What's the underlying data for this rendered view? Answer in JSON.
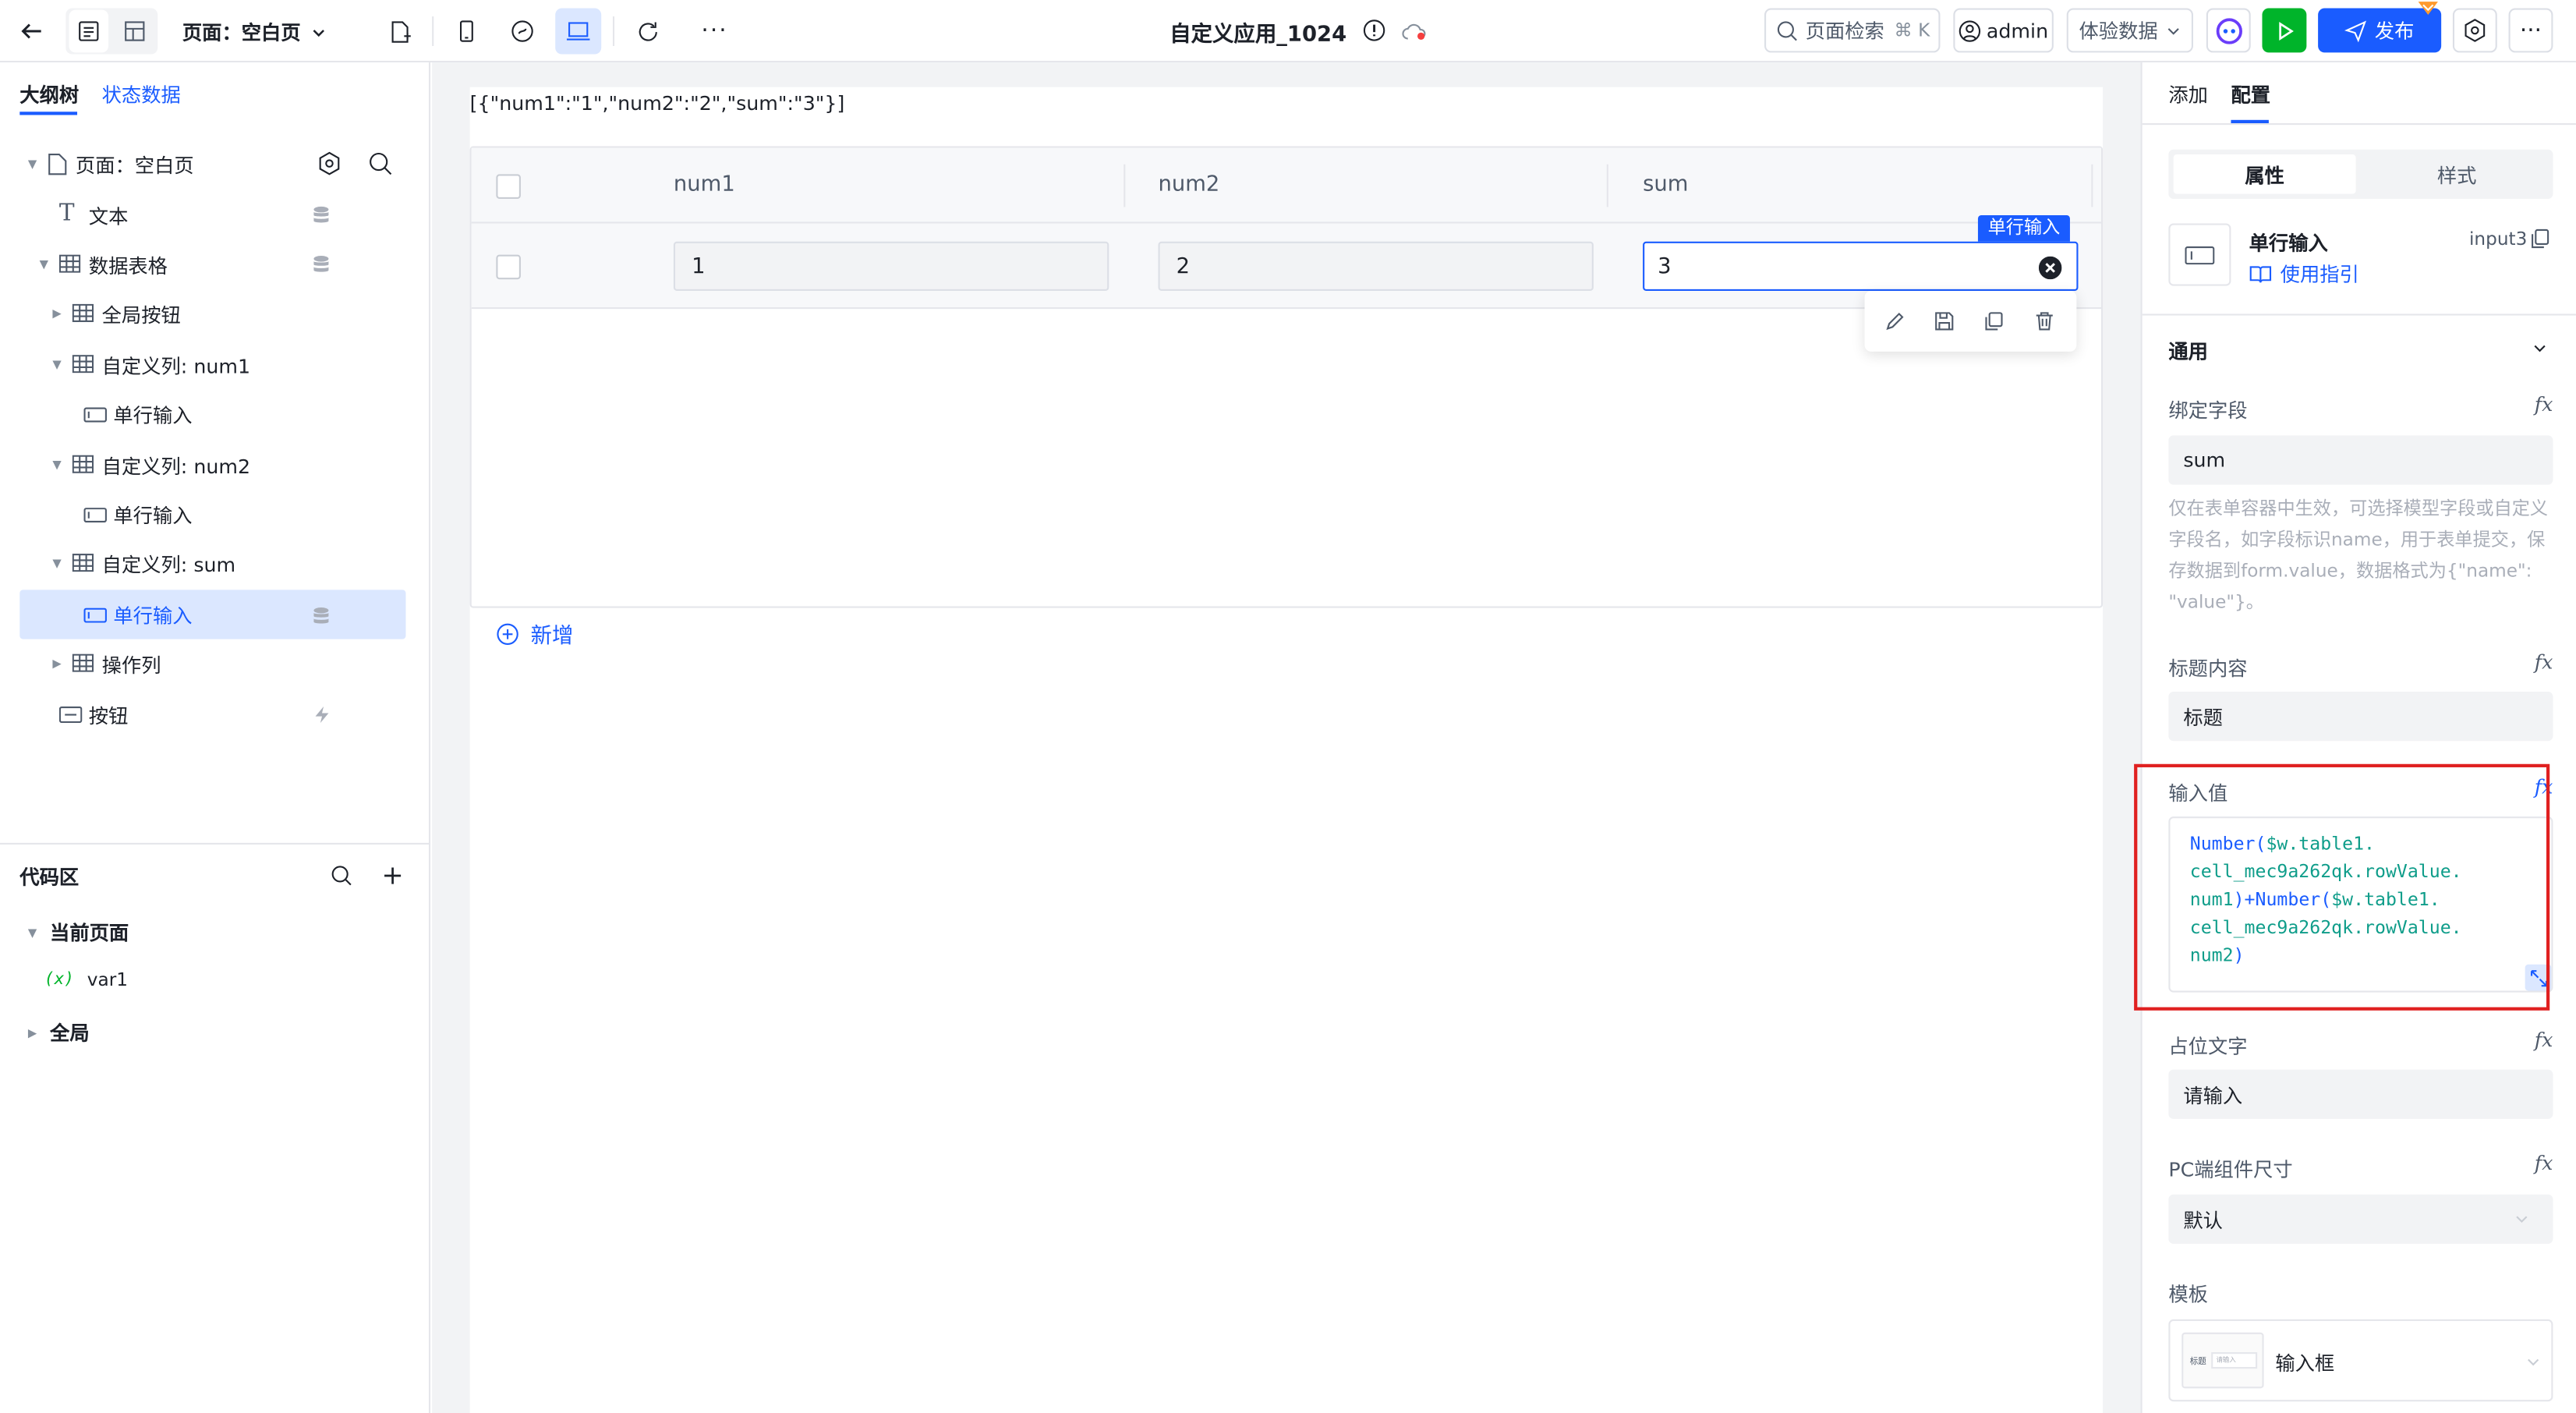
{
  "header": {
    "page_selector": "页面：空白页",
    "app_title": "自定义应用_1024",
    "search_label": "页面检索",
    "search_shortcut": "⌘ K",
    "user": "admin",
    "preview_data": "体验数据",
    "publish": "发布"
  },
  "left": {
    "tabs": [
      "大纲树",
      "状态数据"
    ],
    "tree": [
      {
        "label": "页面：空白页"
      },
      {
        "label": "文本"
      },
      {
        "label": "数据表格"
      },
      {
        "label": "全局按钮"
      },
      {
        "label": "自定义列: num1"
      },
      {
        "label": "单行输入"
      },
      {
        "label": "自定义列: num2"
      },
      {
        "label": "单行输入"
      },
      {
        "label": "自定义列: sum"
      },
      {
        "label": "单行输入"
      },
      {
        "label": "操作列"
      },
      {
        "label": "按钮"
      }
    ],
    "code_area": {
      "title": "代码区",
      "current_page": "当前页面",
      "var_icon": "(x)",
      "var": "var1",
      "global": "全局"
    }
  },
  "canvas": {
    "json_text": "[{\"num1\":\"1\",\"num2\":\"2\",\"sum\":\"3\"}]",
    "columns": [
      "num1",
      "num2",
      "sum"
    ],
    "row": {
      "num1": "1",
      "num2": "2",
      "sum": "3"
    },
    "selected_tag": "单行输入",
    "add_row": "新增"
  },
  "right": {
    "tabs": [
      "添加",
      "配置"
    ],
    "subtabs": [
      "属性",
      "样式"
    ],
    "component": {
      "name": "单行输入",
      "id": "input3",
      "guide": "使用指引"
    },
    "section": "通用",
    "bind_field_label": "绑定字段",
    "bind_field_value": "sum",
    "bind_help": "仅在表单容器中生效，可选择模型字段或自定义字段名，如字段标识name，用于表单提交，保存数据到form.value，数据格式为{\"name\": \"value\"}。",
    "title_label": "标题内容",
    "title_value": "标题",
    "input_value_label": "输入值",
    "input_value_code": [
      [
        {
          "t": "Number(",
          "c": "fn"
        },
        {
          "t": "$w.table1.",
          "c": "var"
        }
      ],
      [
        {
          "t": "cell_mec9a262qk.rowValue.",
          "c": "var"
        }
      ],
      [
        {
          "t": "num1",
          "c": "var"
        },
        {
          "t": ")+Number(",
          "c": "fn"
        },
        {
          "t": "$w.table1.",
          "c": "var"
        }
      ],
      [
        {
          "t": "cell_mec9a262qk.rowValue.",
          "c": "var"
        }
      ],
      [
        {
          "t": "num2",
          "c": "var"
        },
        {
          "t": ")",
          "c": "fn"
        }
      ]
    ],
    "placeholder_label": "占位文字",
    "placeholder_value": "请输入",
    "size_label": "PC端组件尺寸",
    "size_value": "默认",
    "template_label": "模板",
    "template_value": "输入框",
    "template_thumb_title": "标题",
    "template_thumb_input": "请输入",
    "fx": "fx"
  },
  "colors": {
    "primary": "#1a5cff",
    "accent_green": "#00b42a",
    "highlight_box": "#e02020"
  }
}
